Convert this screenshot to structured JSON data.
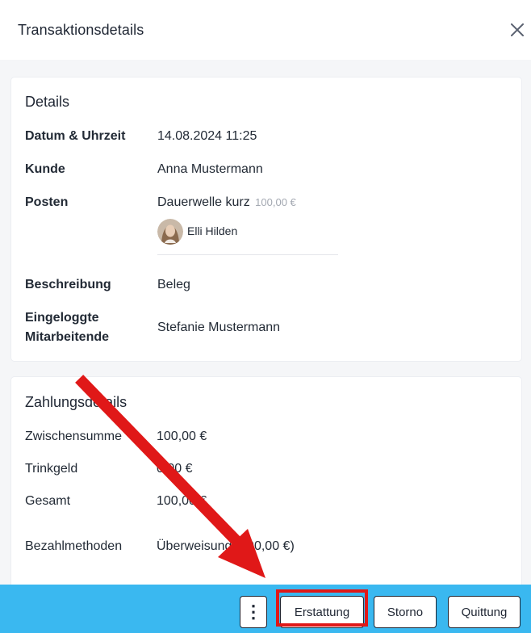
{
  "header": {
    "title": "Transaktionsdetails"
  },
  "details": {
    "title": "Details",
    "datetime_label": "Datum & Uhrzeit",
    "datetime_value": "14.08.2024 11:25",
    "customer_label": "Kunde",
    "customer_value": "Anna Mustermann",
    "items_label": "Posten",
    "item_name": "Dauerwelle kurz",
    "item_price": "100,00 €",
    "staff_name": "Elli Hilden",
    "description_label": "Beschreibung",
    "description_value": "Beleg",
    "logged_in_label_line1": "Eingeloggte",
    "logged_in_label_line2": "Mitarbeitende",
    "logged_in_value": "Stefanie Mustermann"
  },
  "payment": {
    "title": "Zahlungsdetails",
    "subtotal_label": "Zwischensumme",
    "subtotal_value": "100,00 €",
    "tip_label": "Trinkgeld",
    "tip_value": "0,00 €",
    "total_label": "Gesamt",
    "total_value": "100,00 €",
    "methods_label": "Bezahlmethoden",
    "methods_value": "Überweisung (100,00 €)"
  },
  "footer": {
    "more_label": "⋮",
    "refund_label": "Erstattung",
    "storno_label": "Storno",
    "receipt_label": "Quittung"
  },
  "colors": {
    "footer_bg": "#3ab8f0",
    "annotation_red": "#e01818"
  },
  "icons": {
    "close": "close-icon",
    "more": "more-vertical-icon"
  }
}
